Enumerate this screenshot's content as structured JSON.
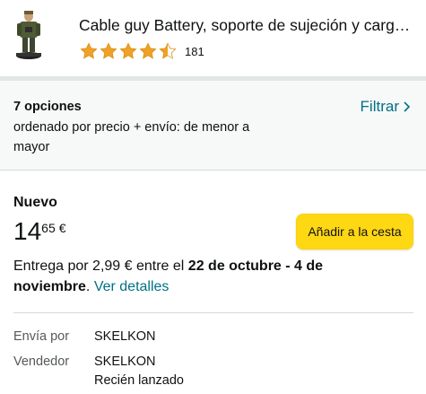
{
  "product": {
    "title": "Cable guy Battery, soporte de sujeción y carg…",
    "rating_stars": 4.5,
    "rating_count": "181",
    "star_color": "#f0a127",
    "thumbnail_icon": "figure-thumbnail"
  },
  "options": {
    "count_label": "7 opciones",
    "sort_label": "ordenado por precio + envío: de menor a mayor",
    "filter_label": "Filtrar",
    "filter_icon": "chevron-right-icon"
  },
  "offer": {
    "condition": "Nuevo",
    "price_whole": "14",
    "price_fraction": "65",
    "currency": "€",
    "add_to_cart_label": "Añadir a la cesta",
    "add_to_cart_color": "#ffd814",
    "delivery_prefix": "Entrega por 2,99 € entre el ",
    "delivery_dates": "22 de octubre - 4 de noviembre",
    "delivery_suffix": ". ",
    "details_link": "Ver detalles",
    "ships_from_label": "Envía por",
    "ships_from_value": "SKELKON",
    "seller_label": "Vendedor",
    "seller_value": "SKELKON",
    "seller_note": "Recién lanzado",
    "link_color": "#007185"
  }
}
